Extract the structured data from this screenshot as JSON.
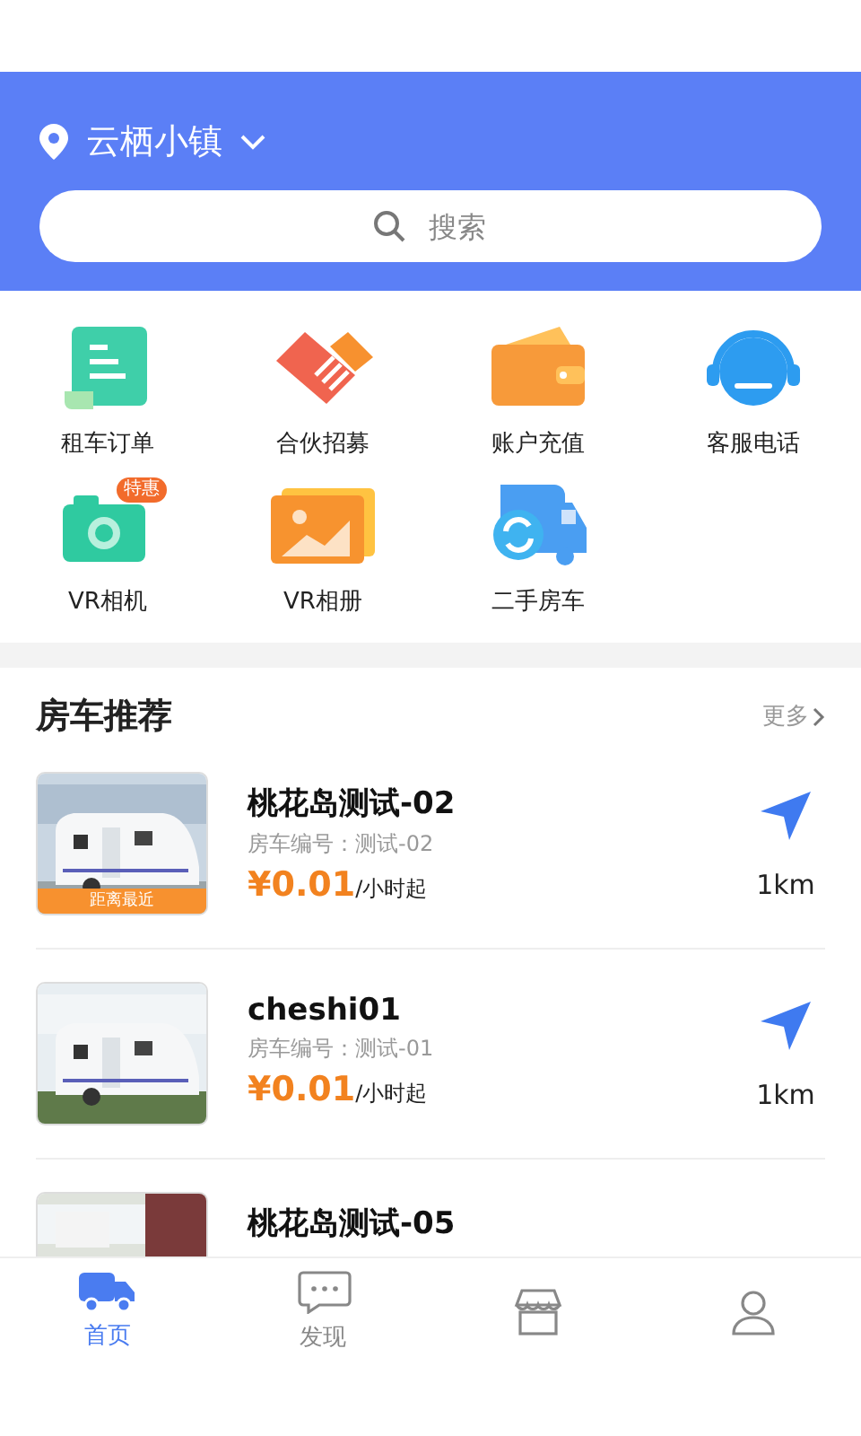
{
  "location": "云栖小镇",
  "search": {
    "placeholder": "搜索"
  },
  "shortcuts": [
    {
      "label": "租车订单",
      "kind": "order"
    },
    {
      "label": "合伙招募",
      "kind": "partner"
    },
    {
      "label": "账户充值",
      "kind": "wallet"
    },
    {
      "label": "客服电话",
      "kind": "service"
    },
    {
      "label": "VR相机",
      "kind": "camera",
      "badge": "特惠"
    },
    {
      "label": "VR相册",
      "kind": "album"
    },
    {
      "label": "二手房车",
      "kind": "used"
    }
  ],
  "section": {
    "title": "房车推荐",
    "more": "更多"
  },
  "vehicles": [
    {
      "name": "桃花岛测试-02",
      "code": "房车编号：测试-02",
      "price": "¥0.01",
      "unit": "/小时起",
      "distance": "1km",
      "tag": "距离最近"
    },
    {
      "name": "cheshi01",
      "code": "房车编号：测试-01",
      "price": "¥0.01",
      "unit": "/小时起",
      "distance": "1km"
    },
    {
      "name": "桃花岛测试-05"
    }
  ],
  "tabs": [
    {
      "label": "首页",
      "kind": "home",
      "selected": true
    },
    {
      "label": "发现",
      "kind": "discover",
      "selected": false
    },
    {
      "kind": "shop",
      "selected": false
    },
    {
      "kind": "profile",
      "selected": false
    }
  ]
}
